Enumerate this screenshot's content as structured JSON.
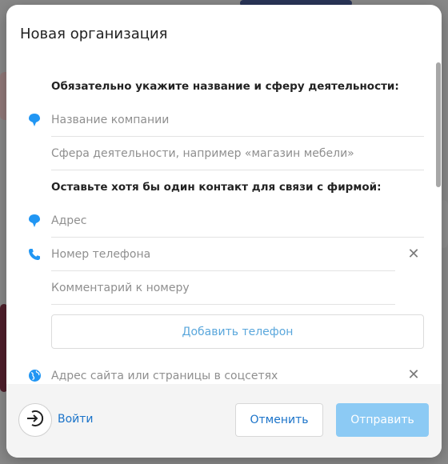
{
  "modal": {
    "title": "Новая организация"
  },
  "form": {
    "required_heading": "Обязательно укажите название и сферу деятельности:",
    "company_name_placeholder": "Название компании",
    "activity_placeholder": "Сфера деятельности, например «магазин мебели»",
    "contact_heading": "Оставьте хотя бы один контакт для связи с фирмой:",
    "address_placeholder": "Адрес",
    "phone_placeholder": "Номер телефона",
    "phone_comment_placeholder": "Комментарий к номеру",
    "add_phone_label": "Добавить телефон",
    "website_placeholder": "Адрес сайта или страницы в соцсетях"
  },
  "footer": {
    "login_label": "Войти",
    "cancel_label": "Отменить",
    "submit_label": "Отправить"
  },
  "icons": {
    "pin": "map-pin-icon",
    "phone": "phone-icon",
    "globe": "globe-icon",
    "clear": "close-icon",
    "login": "login-icon"
  },
  "colors": {
    "accent": "#1a73c9",
    "icon_blue": "#2196f3",
    "submit_disabled": "#8ccaf4"
  }
}
